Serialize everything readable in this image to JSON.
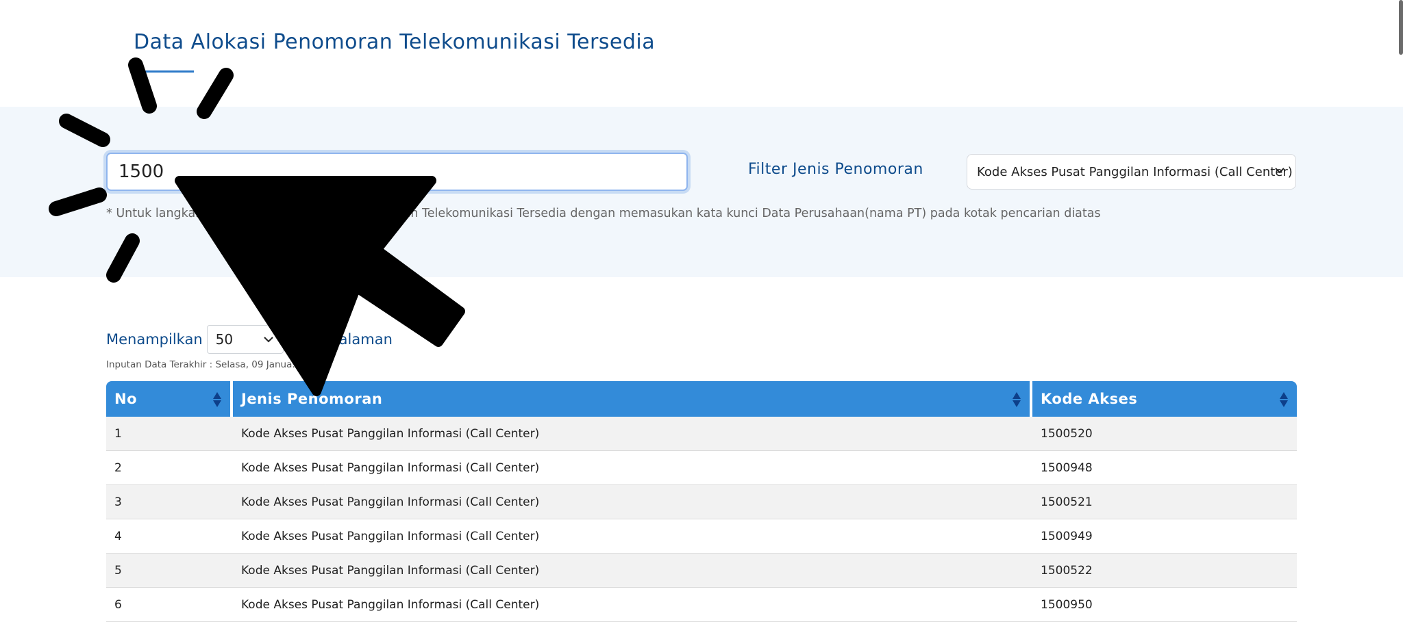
{
  "page": {
    "title": "Data Alokasi Penomoran Telekomunikasi Tersedia"
  },
  "search": {
    "value": "1500",
    "filter_label": "Filter Jenis Penomoran",
    "filter_selected": "Kode Akses Pusat Panggilan Informasi (Call Center)",
    "hint": "* Untuk langkah… mencari Data Alokasi Penomoran Telekomunikasi Tersedia dengan memasukan kata kunci Data Perusahaan(nama PT) pada kotak pencarian diatas"
  },
  "paging": {
    "show_label": "Menampilkan",
    "per_page_value": "50",
    "per_page_suffix": "…er Halaman",
    "last_input": "Inputan Data Terakhir : Selasa, 09 Janua… 4"
  },
  "table": {
    "headers": [
      "No",
      "Jenis Penomoran",
      "Kode Akses"
    ],
    "rows": [
      [
        "1",
        "Kode Akses Pusat Panggilan Informasi (Call Center)",
        "1500520"
      ],
      [
        "2",
        "Kode Akses Pusat Panggilan Informasi (Call Center)",
        "1500948"
      ],
      [
        "3",
        "Kode Akses Pusat Panggilan Informasi (Call Center)",
        "1500521"
      ],
      [
        "4",
        "Kode Akses Pusat Panggilan Informasi (Call Center)",
        "1500949"
      ],
      [
        "5",
        "Kode Akses Pusat Panggilan Informasi (Call Center)",
        "1500522"
      ],
      [
        "6",
        "Kode Akses Pusat Panggilan Informasi (Call Center)",
        "1500950"
      ]
    ]
  },
  "icons": {
    "sort": "sort-icon",
    "dropdown": "chevron-down-icon",
    "cursor": "mouse-pointer-icon"
  },
  "colors": {
    "header_bg": "#338bd9",
    "title": "#0f4c8c",
    "band_bg": "#f2f7fc"
  }
}
